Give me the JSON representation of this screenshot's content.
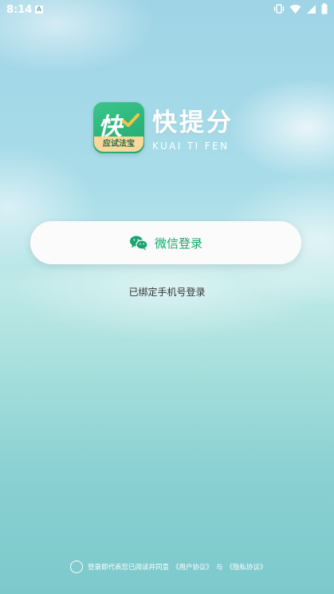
{
  "status_bar": {
    "time": "8:14",
    "notification_glyph": "A",
    "icons": [
      "vibrate-icon",
      "wifi-icon",
      "signal-icon",
      "battery-icon"
    ]
  },
  "app": {
    "logo_glyph": "快",
    "logo_ribbon": "应试法宝",
    "name": "快提分",
    "subtitle": "KUAI TI FEN"
  },
  "login": {
    "wechat_label": "微信登录",
    "phone_label": "已绑定手机号登录"
  },
  "agreement": {
    "text": "登录即代表您已阅读并同意",
    "user_agreement": "《用户协议》",
    "conjunction": "与",
    "privacy_agreement": "《隐私协议》"
  },
  "colors": {
    "brand_green": "#17a66b",
    "logo_ribbon": "#f7d79a"
  }
}
